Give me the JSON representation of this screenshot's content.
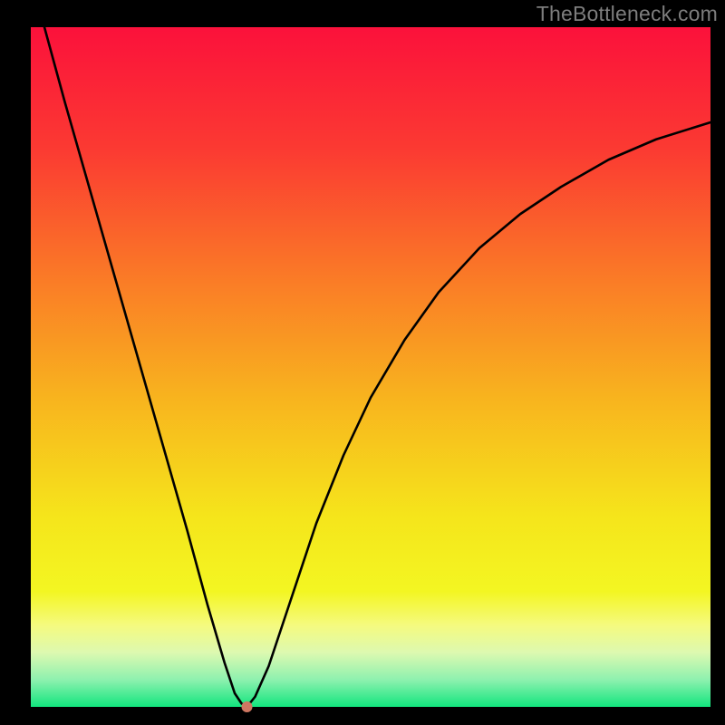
{
  "attribution": "TheBottleneck.com",
  "chart_data": {
    "type": "line",
    "title": "",
    "xlabel": "",
    "ylabel": "",
    "xlim": [
      0,
      100
    ],
    "ylim": [
      0,
      100
    ],
    "grid": false,
    "background_gradient": {
      "type": "vertical",
      "stops": [
        {
          "pos": 0.0,
          "color": "#fb113b"
        },
        {
          "pos": 0.18,
          "color": "#fb3a32"
        },
        {
          "pos": 0.38,
          "color": "#fa7e26"
        },
        {
          "pos": 0.55,
          "color": "#f8b51e"
        },
        {
          "pos": 0.72,
          "color": "#f5e51b"
        },
        {
          "pos": 0.83,
          "color": "#f3f622"
        },
        {
          "pos": 0.88,
          "color": "#f5fa7f"
        },
        {
          "pos": 0.92,
          "color": "#ddf9b0"
        },
        {
          "pos": 0.96,
          "color": "#8ef1af"
        },
        {
          "pos": 1.0,
          "color": "#12e57e"
        }
      ]
    },
    "series": [
      {
        "name": "bottleneck-curve",
        "color": "#000000",
        "x": [
          2,
          5,
          8,
          11,
          14,
          17,
          20,
          23,
          26,
          28.5,
          30,
          31,
          31.8,
          33,
          35,
          38,
          42,
          46,
          50,
          55,
          60,
          66,
          72,
          78,
          85,
          92,
          100
        ],
        "y": [
          100,
          89,
          78.5,
          68,
          57.5,
          47,
          36.5,
          26,
          15,
          6.5,
          2,
          0.5,
          0,
          1.5,
          6,
          15,
          27,
          37,
          45.5,
          54,
          61,
          67.5,
          72.5,
          76.5,
          80.5,
          83.5,
          86
        ]
      }
    ],
    "marker": {
      "name": "optimal-point",
      "x": 31.8,
      "y": 0,
      "color": "#cf7762",
      "radius_px": 6
    }
  }
}
